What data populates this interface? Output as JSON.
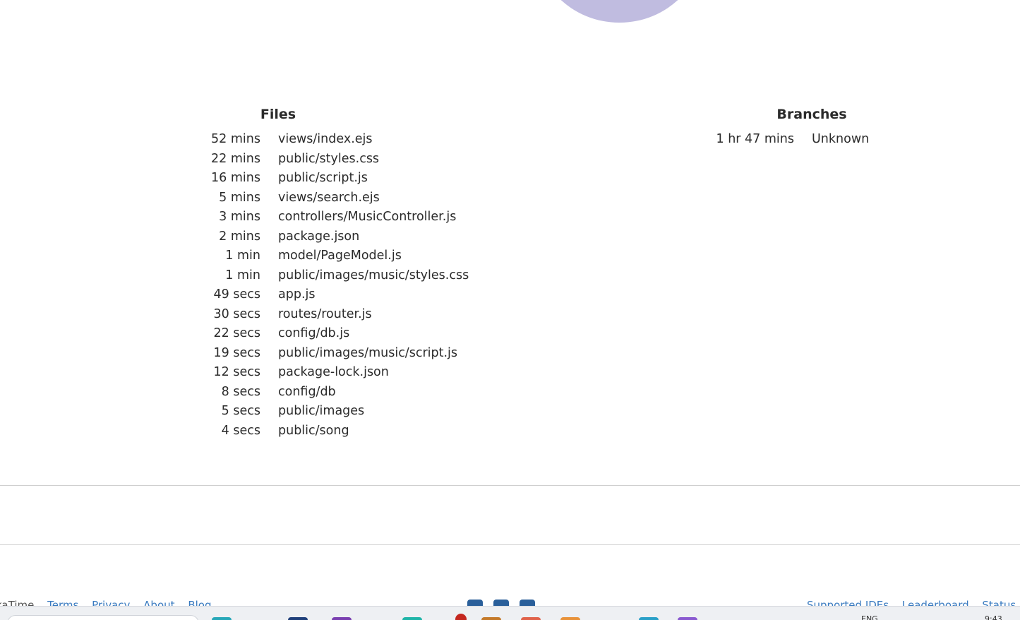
{
  "files_section": {
    "title": "Files",
    "rows": [
      {
        "time": "52 mins",
        "name": "views/index.ejs"
      },
      {
        "time": "22 mins",
        "name": "public/styles.css"
      },
      {
        "time": "16 mins",
        "name": "public/script.js"
      },
      {
        "time": "5 mins",
        "name": "views/search.ejs"
      },
      {
        "time": "3 mins",
        "name": "controllers/MusicController.js"
      },
      {
        "time": "2 mins",
        "name": "package.json"
      },
      {
        "time": "1 min",
        "name": "model/PageModel.js"
      },
      {
        "time": "1 min",
        "name": "public/images/music/styles.css"
      },
      {
        "time": "49 secs",
        "name": "app.js"
      },
      {
        "time": "30 secs",
        "name": "routes/router.js"
      },
      {
        "time": "22 secs",
        "name": "config/db.js"
      },
      {
        "time": "19 secs",
        "name": "public/images/music/script.js"
      },
      {
        "time": "12 secs",
        "name": "package-lock.json"
      },
      {
        "time": "8 secs",
        "name": "config/db"
      },
      {
        "time": "5 secs",
        "name": "public/images"
      },
      {
        "time": "4 secs",
        "name": "public/song"
      }
    ]
  },
  "branches_section": {
    "title": "Branches",
    "rows": [
      {
        "time": "1 hr 47 mins",
        "name": "Unknown"
      }
    ]
  },
  "footer": {
    "brand": "kaTime",
    "links_left": [
      "Terms",
      "Privacy",
      "About",
      "Blog"
    ],
    "links_right": [
      "Supported IDEs",
      "Leaderboard",
      "Status"
    ],
    "social_icons": [
      "github-icon",
      "twitter-icon",
      "linkedin-icon"
    ]
  },
  "taskbar": {
    "language": "ENG",
    "clock": "9:43",
    "notification_count": "1"
  },
  "colors": {
    "pie_slice": "#c0bce0",
    "link": "#3a7bc0",
    "text": "#2b2b2b"
  }
}
